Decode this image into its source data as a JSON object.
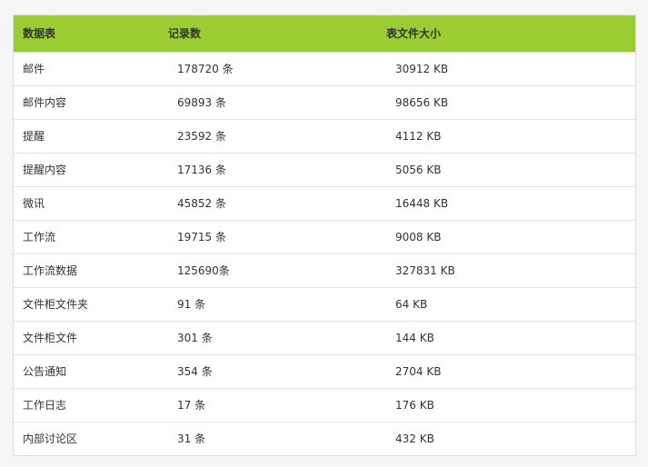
{
  "table": {
    "headers": [
      "数据表",
      "记录数",
      "表文件大小"
    ],
    "rows": [
      [
        "邮件",
        "178720 条",
        "30912 KB"
      ],
      [
        "邮件内容",
        "69893 条",
        "98656 KB"
      ],
      [
        "提醒",
        "23592 条",
        "4112 KB"
      ],
      [
        "提醒内容",
        "17136 条",
        "5056 KB"
      ],
      [
        "微讯",
        "45852 条",
        "16448 KB"
      ],
      [
        "工作流",
        "19715 条",
        "9008 KB"
      ],
      [
        "工作流数据",
        "125690条",
        "327831 KB"
      ],
      [
        "文件柜文件夹",
        "91 条",
        "64 KB"
      ],
      [
        "文件柜文件",
        "301 条",
        "144 KB"
      ],
      [
        "公告通知",
        "354 条",
        "2704 KB"
      ],
      [
        "工作日志",
        "17 条",
        "176 KB"
      ],
      [
        "内部讨论区",
        "31 条",
        "432 KB"
      ]
    ]
  },
  "colors": {
    "header_bg": "#9acd32",
    "border": "#e3e3e3",
    "text": "#333333"
  }
}
